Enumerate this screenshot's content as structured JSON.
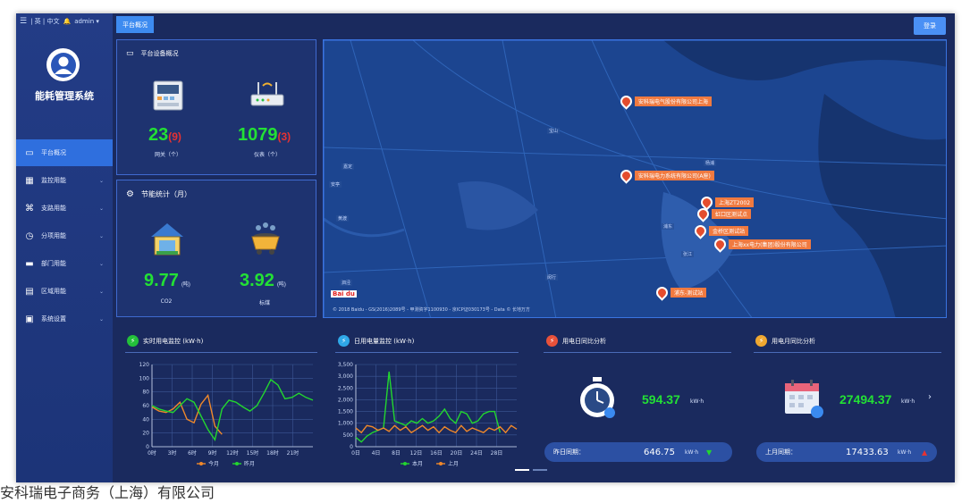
{
  "topbar": {
    "lang": "| 英 | 中文",
    "user": "admin ▾"
  },
  "app": {
    "title": "能耗管理系统"
  },
  "tabs": {
    "overview": "平台概况"
  },
  "top_button": {
    "label": "登录"
  },
  "nav": [
    {
      "label": "平台概况",
      "icon": "monitor-icon"
    },
    {
      "label": "监控用能",
      "icon": "building-icon"
    },
    {
      "label": "支路用能",
      "icon": "branch-icon"
    },
    {
      "label": "分项用能",
      "icon": "clock-icon"
    },
    {
      "label": "部门用能",
      "icon": "folder-icon"
    },
    {
      "label": "区域用能",
      "icon": "grid-icon"
    },
    {
      "label": "系统设置",
      "icon": "settings-icon"
    }
  ],
  "device_panel": {
    "title": "平台设备概况",
    "gateway": {
      "value": "23",
      "offline": "(9)",
      "caption": "网关（个）"
    },
    "meter": {
      "value": "1079",
      "offline": "(3)",
      "caption": "仪表（个）"
    }
  },
  "energy_panel": {
    "title": "节能统计（月）",
    "item1": {
      "value": "9.77",
      "unit": "(吨)",
      "caption": "CO2"
    },
    "item2": {
      "value": "3.92",
      "unit": "(吨)",
      "caption": "标煤"
    }
  },
  "map": {
    "markers": [
      {
        "label": "安科瑞电气股份有限公司上海"
      },
      {
        "label": "安科瑞电力系统有限公司(A座)"
      },
      {
        "label": "上海ZT2002"
      },
      {
        "label": "虹口区测试点"
      },
      {
        "label": "金桥区测试站"
      },
      {
        "label": "上海xx电力(集团)股份有限公司"
      },
      {
        "label": "浦东-测试站"
      }
    ],
    "credit": "© 2018 Baidu - GS(2016)2089号 - 甲测资字1100930 - 京ICP证030173号 - Data © 长地万方",
    "baidu": "Bai du"
  },
  "chart_daily": {
    "title": "实时用电监控 (kW·h)",
    "chart_data": {
      "type": "line",
      "x": [
        0,
        1,
        2,
        3,
        4,
        5,
        6,
        7,
        8,
        9,
        10,
        11,
        12,
        13,
        14,
        15,
        16,
        17,
        18,
        19,
        20,
        21,
        22,
        23
      ],
      "xticks": [
        "0时",
        "3时",
        "6时",
        "9时",
        "12时",
        "15时",
        "18时",
        "21时"
      ],
      "ylim": [
        0,
        120
      ],
      "yticks": [
        "0",
        "20",
        "40",
        "60",
        "80",
        "100",
        "120"
      ],
      "series": [
        {
          "name": "今月",
          "color": "#f0882a",
          "values": [
            58,
            52,
            50,
            55,
            65,
            40,
            35,
            62,
            75,
            30,
            18
          ]
        },
        {
          "name": "昨月",
          "color": "#23d62f",
          "values": [
            60,
            55,
            52,
            50,
            60,
            70,
            65,
            45,
            25,
            10,
            55,
            68,
            65,
            58,
            52,
            60,
            78,
            98,
            90,
            70,
            72,
            78,
            72,
            68
          ]
        }
      ]
    }
  },
  "chart_monthly": {
    "title": "日用电量监控 (kW·h)",
    "chart_data": {
      "type": "line",
      "x": [
        1,
        2,
        3,
        4,
        5,
        6,
        7,
        8,
        9,
        10,
        11,
        12,
        13,
        14,
        15,
        16,
        17,
        18,
        19,
        20,
        21,
        22,
        23,
        24,
        25,
        26,
        27,
        28,
        29,
        30
      ],
      "xticks": [
        "0日",
        "4日",
        "8日",
        "12日",
        "16日",
        "20日",
        "24日",
        "28日"
      ],
      "ylim": [
        0,
        3500
      ],
      "yticks": [
        "0",
        "500",
        "1,000",
        "1,500",
        "2,000",
        "2,500",
        "3,000",
        "3,500"
      ],
      "series": [
        {
          "name": "本月",
          "color": "#23d62f",
          "values": [
            400,
            200,
            450,
            600,
            700,
            800,
            3200,
            1100,
            1000,
            900,
            1100,
            1000,
            1200,
            1000,
            1100,
            1300,
            1600,
            1200,
            1000,
            1500,
            1400,
            1000,
            1100,
            1400,
            1500,
            1500,
            600
          ]
        },
        {
          "name": "上月",
          "color": "#f0882a",
          "values": [
            800,
            600,
            900,
            850,
            700,
            800,
            650,
            900,
            700,
            850,
            600,
            750,
            900,
            700,
            850,
            600,
            850,
            700,
            600,
            900,
            650,
            800,
            700,
            600,
            800,
            700,
            850,
            600,
            900,
            750
          ]
        }
      ]
    }
  },
  "day_compare": {
    "title": "用电日同比分析",
    "value": "594.37",
    "unit": "kW·h",
    "prev_label": "昨日同期：",
    "prev_value": "646.75",
    "prev_unit": "kW·h"
  },
  "month_compare": {
    "title": "用电月同比分析",
    "value": "27494.37",
    "unit": "kW·h",
    "prev_label": "上月同期：",
    "prev_value": "17433.63",
    "prev_unit": "kW·h"
  },
  "footer": {
    "text": "安科瑞电子商务（上海）有限公司"
  },
  "colors": {
    "green": "#23e035",
    "red": "#e63232",
    "panel": "#1e3370",
    "accent": "#3d8bf0"
  }
}
